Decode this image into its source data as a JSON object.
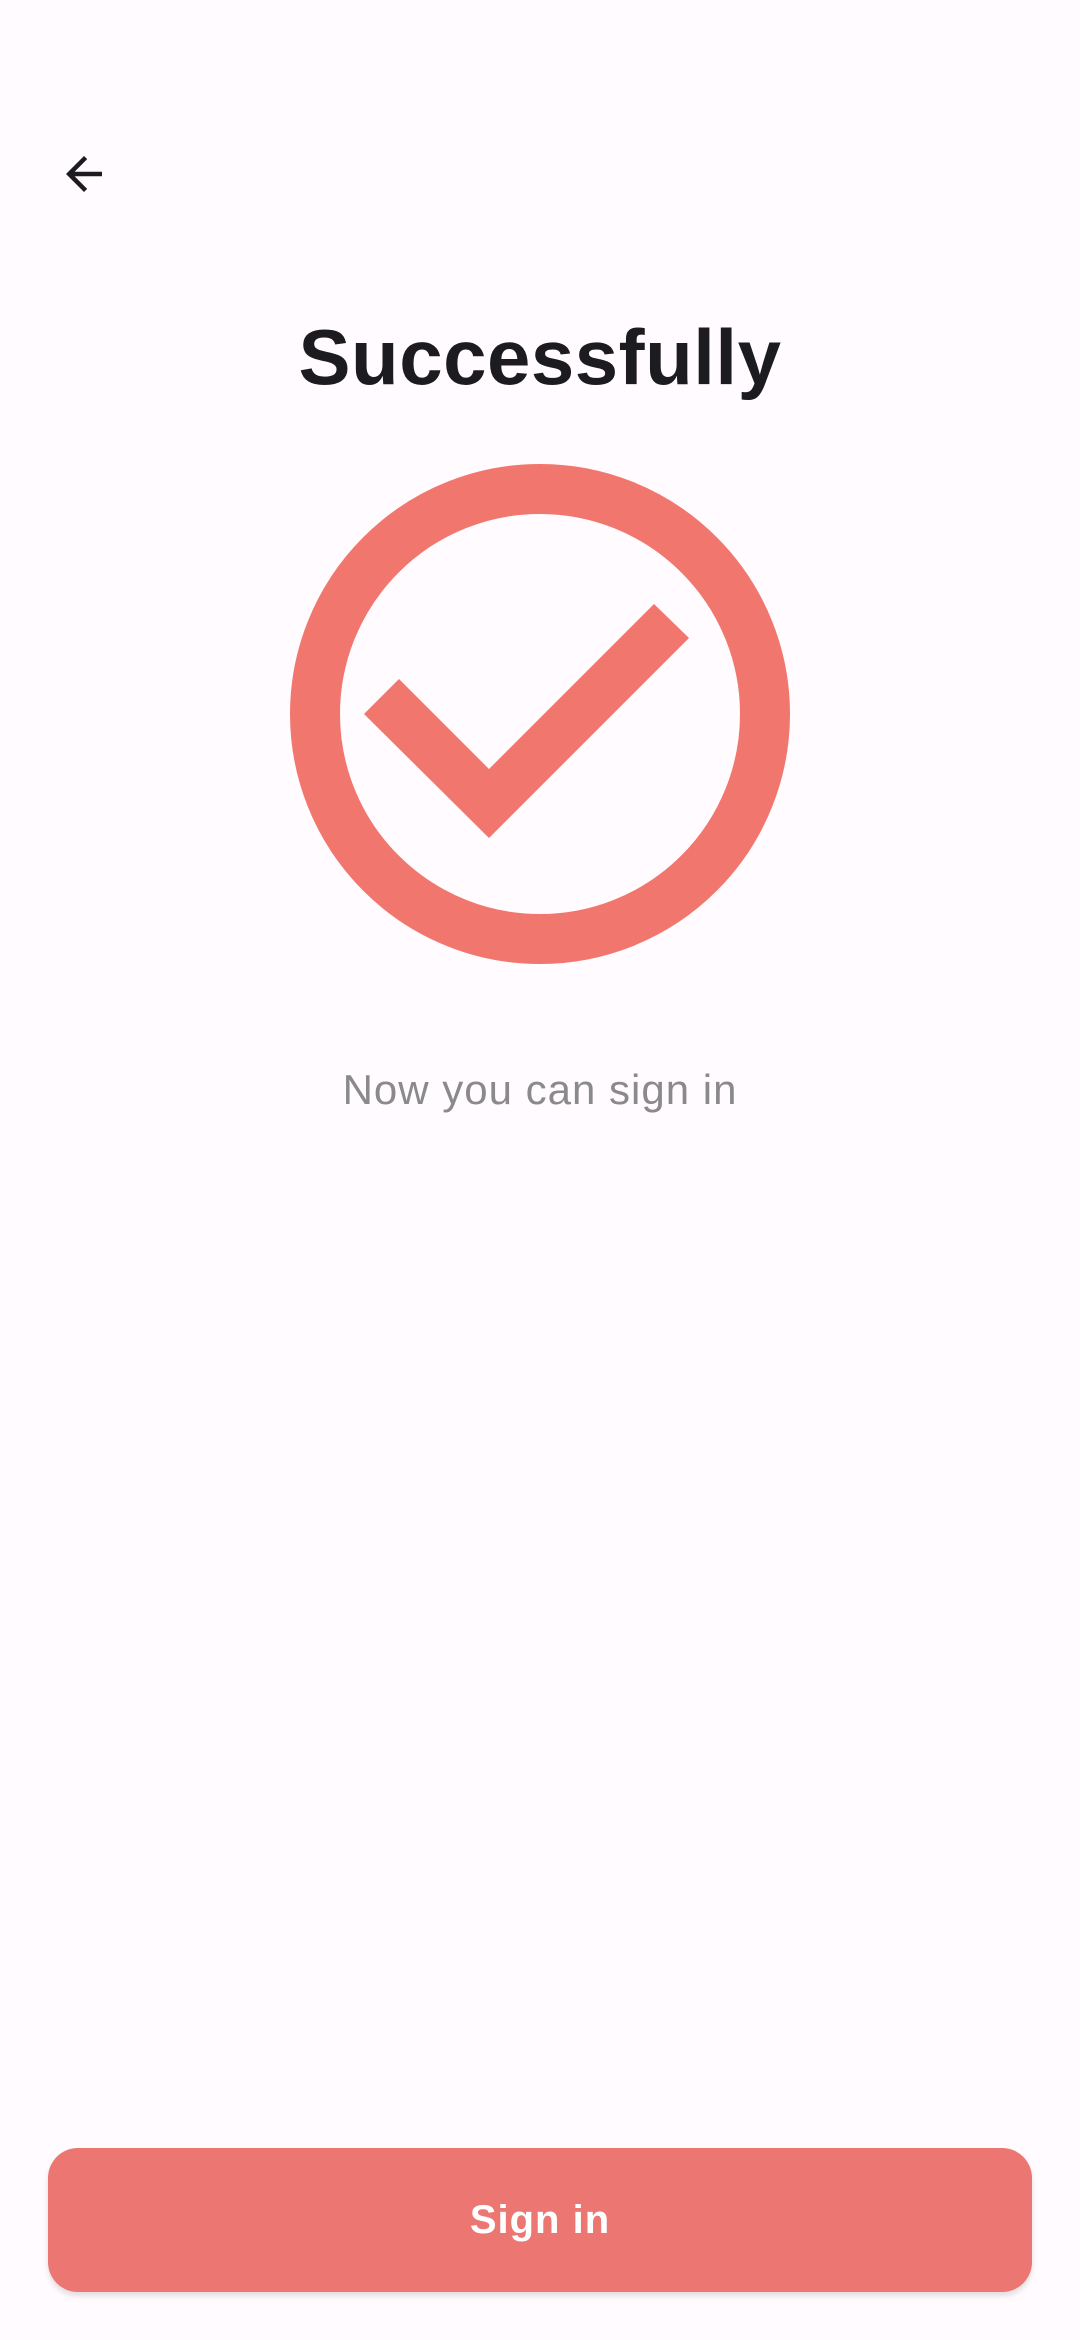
{
  "header": {
    "back_icon": "arrow-left-icon"
  },
  "main": {
    "title": "Successfully",
    "status_icon": "check-circle-icon",
    "subtitle": "Now you can sign in"
  },
  "footer": {
    "signin_label": "Sign in"
  },
  "colors": {
    "accent": "#f1776e",
    "button": "#ec7672",
    "background": "#fffbfe",
    "title_text": "#1c1b1f",
    "subtitle_text": "#8a8a8a"
  }
}
